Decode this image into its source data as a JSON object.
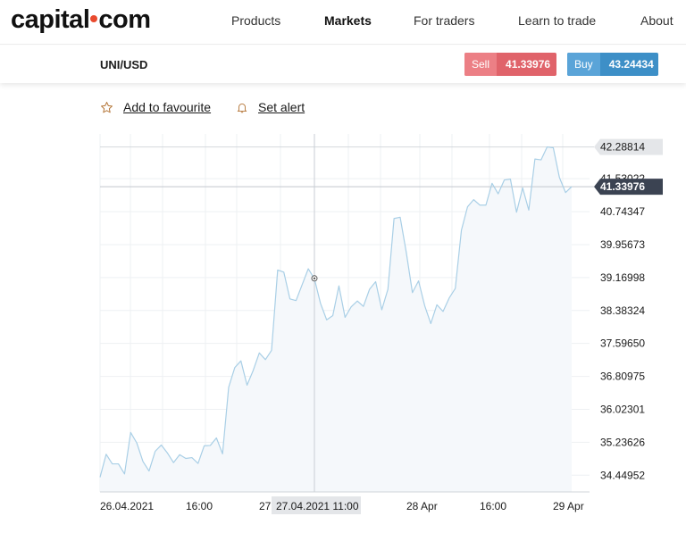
{
  "header": {
    "logo_text_left": "capital",
    "logo_text_right": "com",
    "nav": [
      {
        "label": "Products",
        "active": false
      },
      {
        "label": "Markets",
        "active": true
      },
      {
        "label": "For traders",
        "active": false
      },
      {
        "label": "Learn to trade",
        "active": false
      },
      {
        "label": "About",
        "active": false
      }
    ]
  },
  "instrument": {
    "symbol": "UNI/USD",
    "sell": {
      "label": "Sell",
      "price": "41.33976",
      "color": "#e0636a"
    },
    "buy": {
      "label": "Buy",
      "price": "43.24434",
      "color": "#3d8fc7"
    }
  },
  "actions": {
    "favourite": {
      "label": "Add to favourite",
      "icon": "star-icon"
    },
    "alert": {
      "label": "Set alert",
      "icon": "bell-icon"
    }
  },
  "chart_data": {
    "type": "area",
    "y_ticks": [
      "34.44952",
      "35.23626",
      "36.02301",
      "36.80975",
      "37.59650",
      "38.38324",
      "39.16998",
      "39.95673",
      "40.74347",
      "41.53022"
    ],
    "x_ticks": [
      "26.04.2021",
      "16:00",
      "27",
      "28 Apr",
      "16:00",
      "29 Apr"
    ],
    "ylim": [
      34.05,
      42.6
    ],
    "high_marker": "42.28814",
    "current_marker": "41.33976",
    "crosshair_label": "27.04.2021 11:00",
    "line_color": "#a9cfe6",
    "fill_color": "#f5f8fb",
    "grid": true,
    "series": [
      {
        "x_index": [
          0,
          1,
          2,
          3,
          4,
          5,
          6,
          7,
          8,
          9,
          10,
          11,
          12,
          13,
          14,
          15,
          16,
          17,
          18,
          19,
          20,
          21,
          22,
          23,
          24,
          25,
          26,
          27,
          28,
          29,
          30,
          31,
          32,
          33,
          34,
          35,
          36,
          37,
          38,
          39,
          40,
          41,
          42,
          43,
          44,
          45,
          46,
          47,
          48,
          49,
          50,
          51,
          52,
          53,
          54,
          55,
          56,
          57,
          58,
          59,
          60,
          61,
          62,
          63,
          64,
          65,
          66,
          67,
          68,
          69,
          70,
          71,
          72,
          73,
          74,
          75,
          76,
          77,
          78,
          79,
          80,
          81,
          82,
          83,
          84,
          85,
          86,
          87,
          88,
          89
        ],
        "values": [
          34.4,
          34.95,
          34.72,
          34.72,
          34.48,
          35.47,
          35.22,
          34.78,
          34.55,
          35.02,
          35.17,
          34.98,
          34.75,
          34.94,
          34.85,
          34.87,
          34.73,
          35.15,
          35.16,
          35.34,
          34.96,
          36.55,
          37.02,
          37.18,
          36.6,
          36.95,
          37.37,
          37.21,
          37.43,
          39.35,
          39.3,
          38.66,
          38.62,
          39.0,
          39.38,
          39.14,
          38.55,
          38.16,
          38.26,
          38.97,
          38.22,
          38.47,
          38.61,
          38.48,
          38.89,
          39.07,
          38.4,
          38.89,
          40.58,
          40.61,
          39.77,
          38.81,
          39.09,
          38.5,
          38.07,
          38.52,
          38.36,
          38.68,
          38.91,
          40.3,
          40.86,
          41.03,
          40.9,
          40.9,
          41.42,
          41.17,
          41.5,
          41.52,
          40.73,
          41.31,
          40.78,
          42.0,
          41.98,
          42.29,
          42.27,
          41.56,
          41.2,
          41.34
        ]
      }
    ],
    "crosshair_value": 39.15
  }
}
